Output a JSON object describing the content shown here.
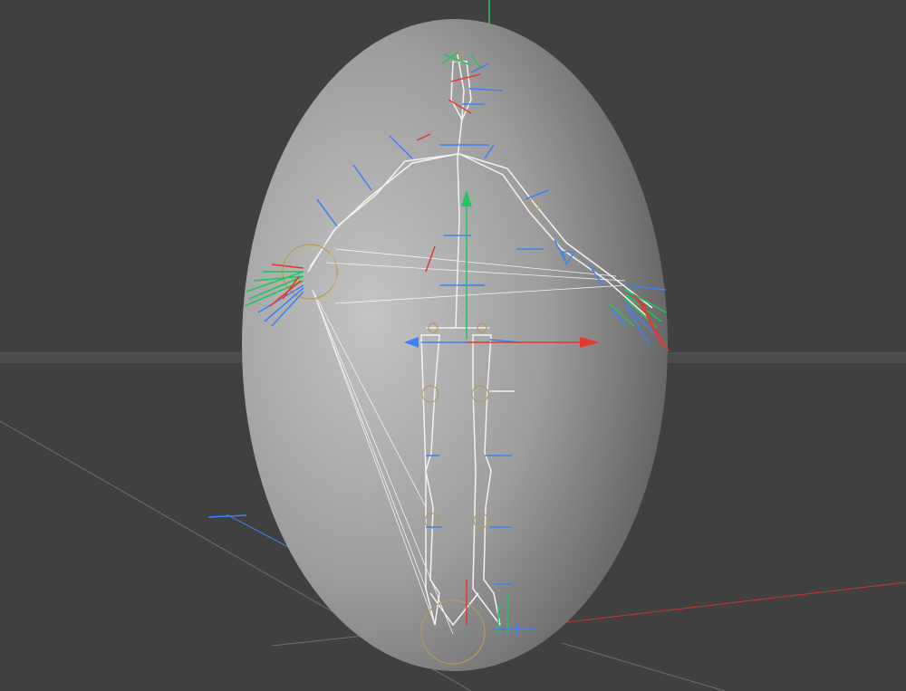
{
  "viewport": {
    "background": "#404040",
    "horizon_color": "#4a4a4a",
    "grid_line_color": "#6e6e6e"
  },
  "axis_colors": {
    "x": "#e23b2e",
    "y": "#22c55e",
    "z": "#3b82f6"
  },
  "object": {
    "shape": "ellipsoid",
    "shading_light": "#bfbfbf",
    "shading_dark": "#5a5a5a"
  },
  "rig": {
    "bone_color": "#f2f2f2",
    "joint_color": "#b59a5a",
    "view": "front"
  },
  "manipulator": {
    "type": "move-gizmo",
    "axes": [
      "x",
      "y",
      "z"
    ]
  }
}
